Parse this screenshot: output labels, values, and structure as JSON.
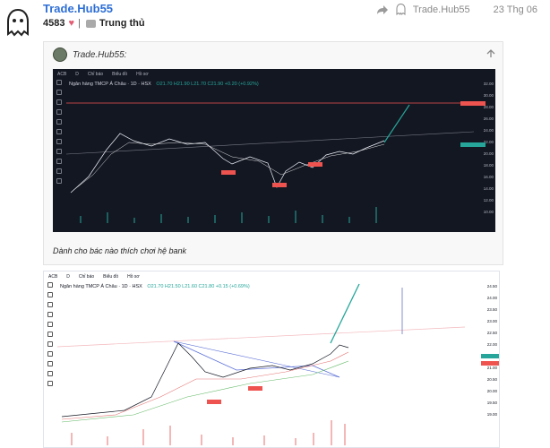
{
  "post": {
    "username": "Trade.Hub55",
    "likes": "4583",
    "award": "Trung thủ",
    "meta_user": "Trade.Hub55",
    "date": "23 Thg 06"
  },
  "quote": {
    "author": "Trade.Hub55:",
    "caption": "Dành cho bác nào thích chơi hệ bank"
  },
  "dark_chart": {
    "toolbar": [
      "ACB",
      "D",
      "Chỉ báo",
      "Biểu đồ",
      "Hồ sơ"
    ],
    "title": "Ngân hàng TMCP Á Châu · 1D · HSX",
    "ohlc": "O21.70 H21.90 L21.70 C21.90 +0.20 (+0.92%)",
    "price_axis": [
      "32.00",
      "30.00",
      "28.00",
      "26.00",
      "24.00",
      "22.00",
      "20.00",
      "18.00",
      "16.00",
      "14.00",
      "12.00",
      "10.00"
    ],
    "labels": [
      "Sai lh.tt",
      "Sai lh.tt",
      "Sai lh.tt"
    ]
  },
  "light_chart": {
    "toolbar": [
      "ACB",
      "D",
      "Chỉ báo",
      "Biểu đồ",
      "Hồ sơ"
    ],
    "title": "Ngân hàng TMCP Á Châu · 1D · HSX",
    "ohlc": "O21.70 H21.50 L21.60 C21.80 +0.15 (+0.69%)",
    "price_axis": [
      "24.50",
      "24.00",
      "23.50",
      "23.00",
      "22.50",
      "22.00",
      "21.50",
      "21.00",
      "20.50",
      "20.00",
      "19.50",
      "19.00"
    ],
    "labels": [
      "Sai lh.tt",
      "Sai lh.tt"
    ]
  },
  "colors": {
    "link": "#2e6fd6",
    "heart": "#e35d74",
    "dark_bg": "#131722",
    "bull": "#26a69a",
    "bear": "#ef5350"
  }
}
